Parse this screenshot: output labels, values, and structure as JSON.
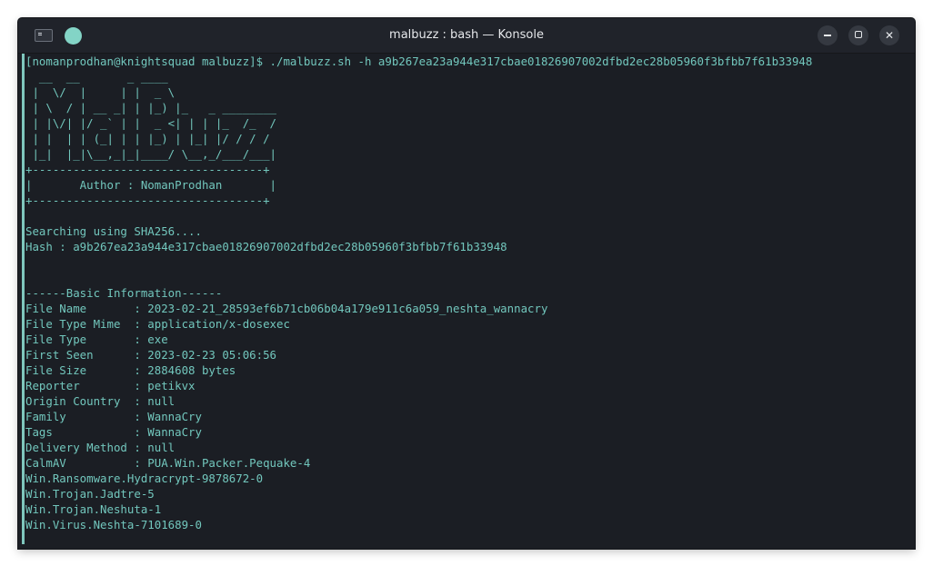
{
  "window": {
    "title": "malbuzz : bash — Konsole",
    "icon": "terminal-icon",
    "controls": {
      "minimize_icon": "minimize-icon",
      "maximize_icon": "maximize-icon",
      "close_icon": "close-icon",
      "close_glyph": "✕"
    }
  },
  "colors": {
    "text": "#72c7bd",
    "background": "#1b1e24",
    "titlebar": "#20232a",
    "accent": "#83d4c6"
  },
  "terminal": {
    "lines": [
      "[nomanprodhan@knightsquad malbuzz]$ ./malbuzz.sh -h a9b267ea23a944e317cbae01826907002dfbd2ec28b05960f3bfbb7f61b33948",
      "  __  __       _ ____",
      " |  \\/  |     | |  _ \\",
      " | \\  / | __ _| | |_) |_   _ ________",
      " | |\\/| |/ _` | |  _ <| | | |_  /_  /",
      " | |  | | (_| | | |_) | |_| |/ / / /",
      " |_|  |_|\\__,_|_|____/ \\__,_/___/___|",
      "+----------------------------------+",
      "|       Author : NomanProdhan       |",
      "+----------------------------------+",
      "",
      "Searching using SHA256....",
      "Hash : a9b267ea23a944e317cbae01826907002dfbd2ec28b05960f3bfbb7f61b33948",
      "",
      "",
      "------Basic Information------",
      "File Name       : 2023-02-21_28593ef6b71cb06b04a179e911c6a059_neshta_wannacry",
      "File Type Mime  : application/x-dosexec",
      "File Type       : exe",
      "First Seen      : 2023-02-23 05:06:56",
      "File Size       : 2884608 bytes",
      "Reporter        : petikvx",
      "Origin Country  : null",
      "Family          : WannaCry",
      "Tags            : WannaCry",
      "Delivery Method : null",
      "CalmAV          : PUA.Win.Packer.Pequake-4",
      "Win.Ransomware.Hydracrypt-9878672-0",
      "Win.Trojan.Jadtre-5",
      "Win.Trojan.Neshuta-1",
      "Win.Virus.Neshta-7101689-0"
    ]
  }
}
